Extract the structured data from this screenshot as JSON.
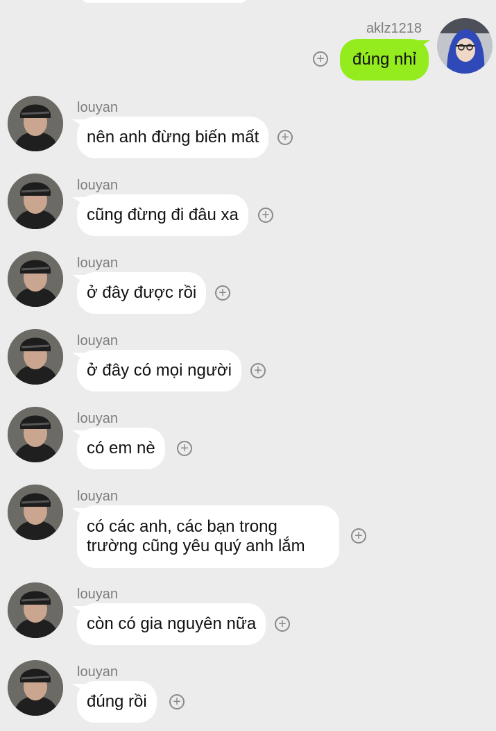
{
  "own": {
    "username": "aklz1218",
    "text": "đúng nhỉ"
  },
  "messages": [
    {
      "sender": "louyan",
      "text": "nên anh đừng biến mất"
    },
    {
      "sender": "louyan",
      "text": "cũng đừng đi đâu xa"
    },
    {
      "sender": "louyan",
      "text": "ở đây được rồi"
    },
    {
      "sender": "louyan",
      "text": "ở đây có mọi người"
    },
    {
      "sender": "louyan",
      "text": "có em nè"
    },
    {
      "sender": "louyan",
      "text": "có các anh, các bạn trong trường cũng yêu quý anh lắm"
    },
    {
      "sender": "louyan",
      "text": "còn có gia nguyên nữa"
    },
    {
      "sender": "louyan",
      "text": "đúng rồi"
    }
  ],
  "icons": {
    "add": "plus-circle-icon",
    "avatar": "user-avatar"
  },
  "colors": {
    "background": "#ececec",
    "own_bubble": "#94ec1e",
    "other_bubble": "#ffffff"
  }
}
